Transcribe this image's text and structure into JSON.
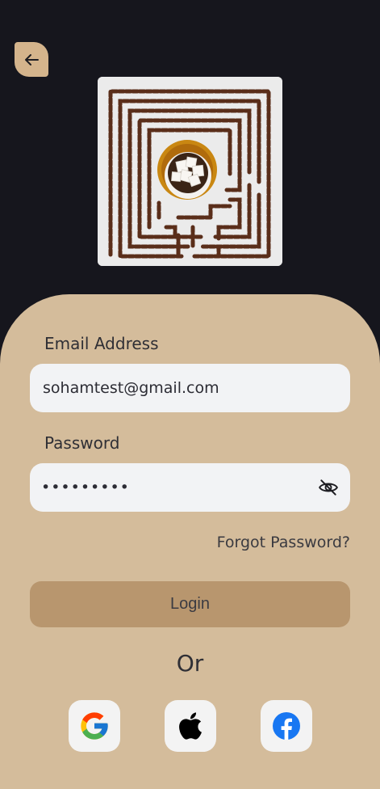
{
  "form": {
    "email_label": "Email Address",
    "email_value": "sohamtest@gmail.com",
    "password_label": "Password",
    "password_masked": "•••••••••",
    "forgot_label": "Forgot Password?",
    "login_label": "Login",
    "or_label": "Or"
  },
  "icons": {
    "back": "arrow-left-icon",
    "visibility": "eye-off-icon",
    "social": [
      "google-icon",
      "apple-icon",
      "facebook-icon"
    ]
  },
  "colors": {
    "background": "#16161d",
    "card": "#d4bc9b",
    "accent": "#d4b48c",
    "button": "#b8966e",
    "field": "#f2f3f5",
    "facebook": "#1877f2"
  }
}
